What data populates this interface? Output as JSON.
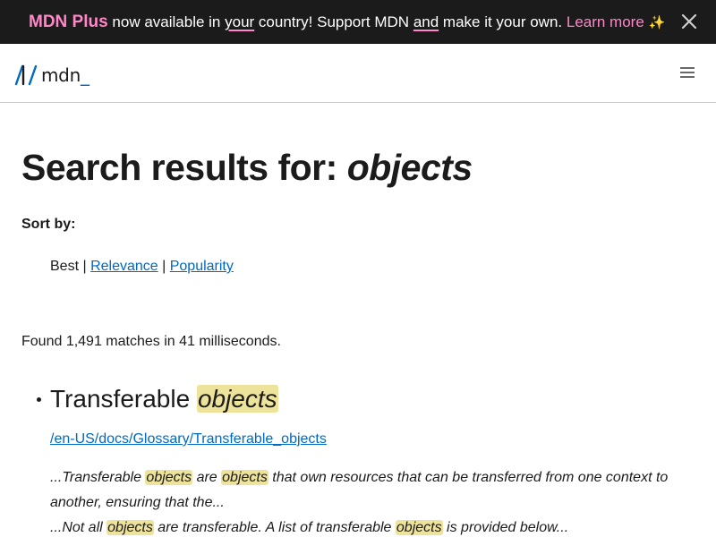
{
  "banner": {
    "brand": "MDN Plus",
    "text_1": " now available in ",
    "text_your": "your",
    "text_2": " country! Support MDN ",
    "text_and": "and",
    "text_3": " make it your own. ",
    "learn_more": "Learn more",
    "sparkle": "✨",
    "close_icon": "close-icon"
  },
  "header": {
    "logo_text": "mdn",
    "logo_underscore": "_",
    "menu_icon": "hamburger-menu-icon"
  },
  "search": {
    "title_prefix": "Search results for: ",
    "query": "objects",
    "sort_label": "Sort by:",
    "sort_best": "Best",
    "sort_sep": " | ",
    "sort_relevance": "Relevance",
    "sort_popularity": "Popularity",
    "found_text": "Found 1,491 matches in 41 milliseconds."
  },
  "results": [
    {
      "title_pre": "Transferable ",
      "title_highlight": "objects",
      "url": "/en-US/docs/Glossary/Transferable_objects",
      "snippet_1": "...Transferable ",
      "snippet_h1": "objects",
      "snippet_2": " are ",
      "snippet_h2": "objects",
      "snippet_3": " that own resources that can be transferred from one context to another, ensuring that the...",
      "snippet_4": "...Not all ",
      "snippet_h3": "objects",
      "snippet_5": " are transferable. A list of transferable ",
      "snippet_h4": "objects",
      "snippet_6": " is provided below..."
    }
  ],
  "colors": {
    "banner_bg": "#1b1b1b",
    "brand_pink": "#ff86c8",
    "link_blue": "#0069c2",
    "highlight": "#eee39a"
  }
}
